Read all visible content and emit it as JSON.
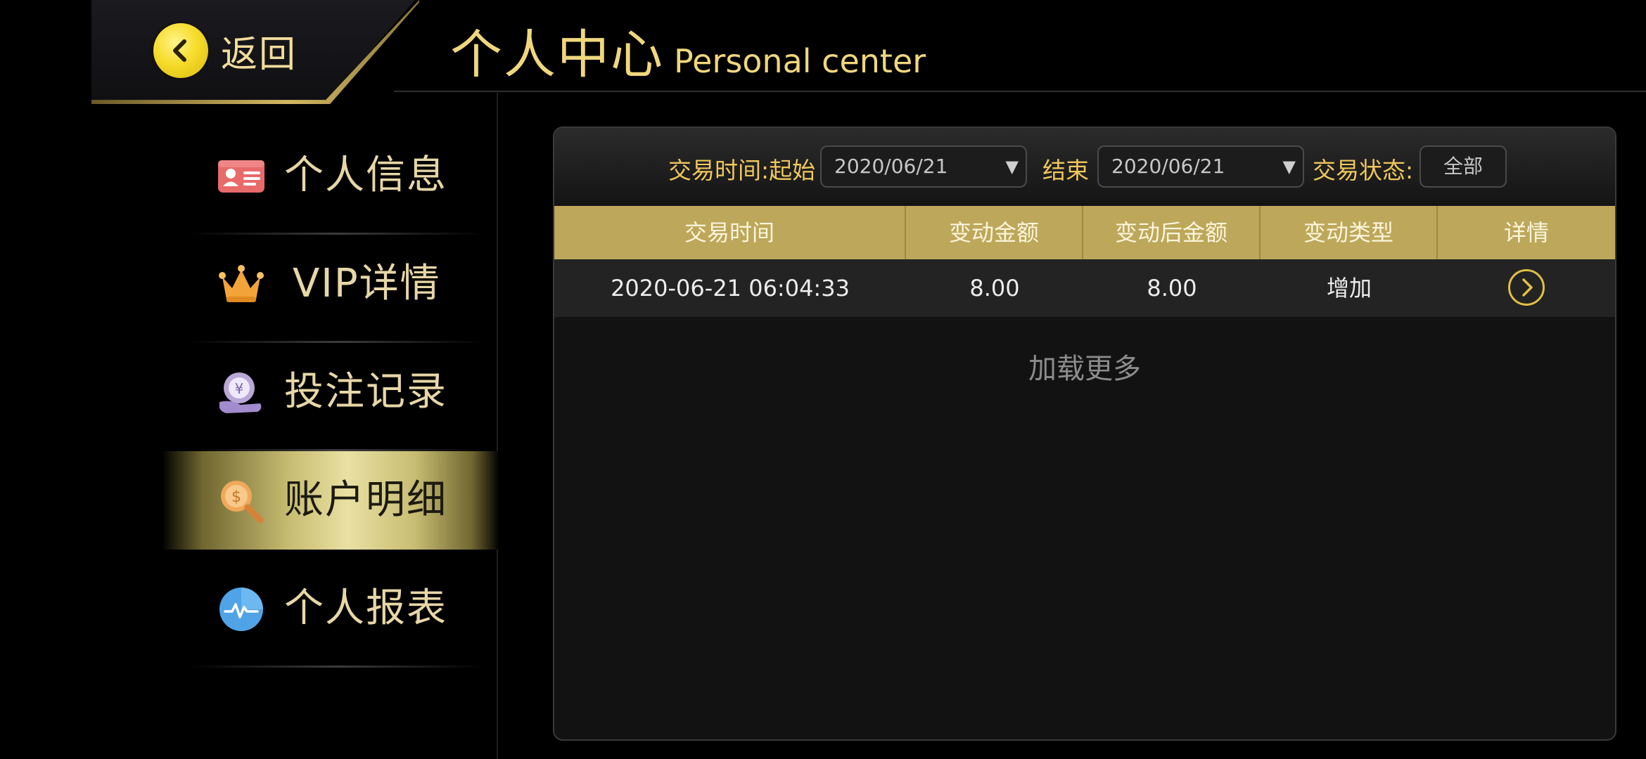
{
  "header": {
    "back_label": "返回",
    "title_zh": "个人中心",
    "title_en": "Personal center"
  },
  "sidebar": {
    "items": [
      {
        "label": "个人信息",
        "icon": "id-card-icon"
      },
      {
        "label": "VIP详情",
        "icon": "crown-icon"
      },
      {
        "label": "投注记录",
        "icon": "bet-record-icon"
      },
      {
        "label": "账户明细",
        "icon": "coin-search-icon",
        "active": true
      },
      {
        "label": "个人报表",
        "icon": "report-chart-icon"
      }
    ]
  },
  "filters": {
    "start_label": "交易时间:起始",
    "start_value": "2020/06/21",
    "end_label": "结束",
    "end_value": "2020/06/21",
    "status_label": "交易状态:",
    "status_value": "全部"
  },
  "table": {
    "headers": [
      "交易时间",
      "变动金额",
      "变动后金额",
      "变动类型",
      "详情"
    ],
    "rows": [
      {
        "time": "2020-06-21 06:04:33",
        "amount": "8.00",
        "balance": "8.00",
        "type": "增加"
      }
    ],
    "load_more": "加载更多"
  },
  "colors": {
    "accent_gold": "#f0d77d",
    "table_header": "#bda75a",
    "background": "#000000"
  }
}
